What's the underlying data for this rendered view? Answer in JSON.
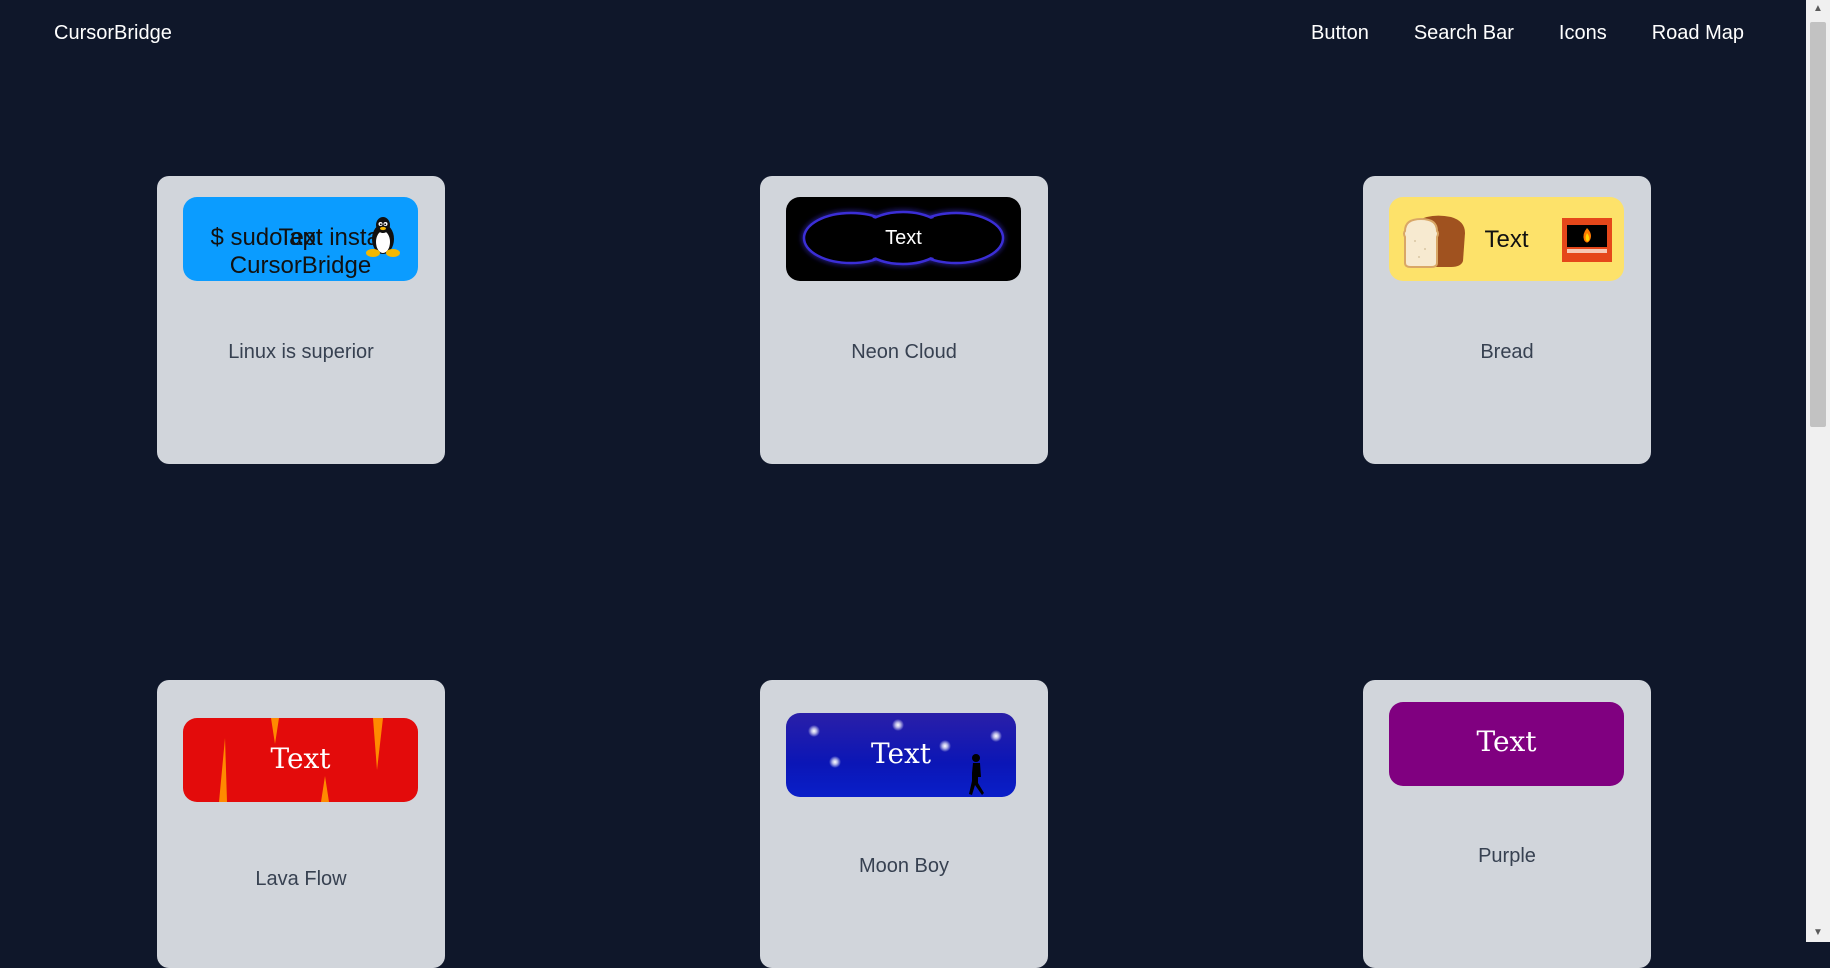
{
  "nav": {
    "brand": "CursorBridge",
    "links": [
      "Button",
      "Search Bar",
      "Icons",
      "Road Map"
    ]
  },
  "cards": [
    {
      "label": "Linux is superior",
      "button_text": "Text",
      "command": "$ sudo apt install CursorBridge",
      "icon": "tux-penguin-icon"
    },
    {
      "label": "Neon Cloud",
      "button_text": "Text"
    },
    {
      "label": "Bread",
      "button_text": "Text",
      "icons": [
        "bread-icon",
        "toaster-fire-icon"
      ]
    },
    {
      "label": "Lava Flow",
      "button_text": "Text"
    },
    {
      "label": "Moon Boy",
      "button_text": "Text",
      "icon": "walking-boy-silhouette-icon"
    },
    {
      "label": "Purple",
      "button_text": "Text"
    }
  ],
  "colors": {
    "background": "#0f172a",
    "card": "#d1d5db",
    "linux": "#0b9cff",
    "neon": "#000000",
    "bread": "#fde26a",
    "lava": "#e30b0b",
    "moon": "#0b16b6",
    "purple": "#800080"
  }
}
